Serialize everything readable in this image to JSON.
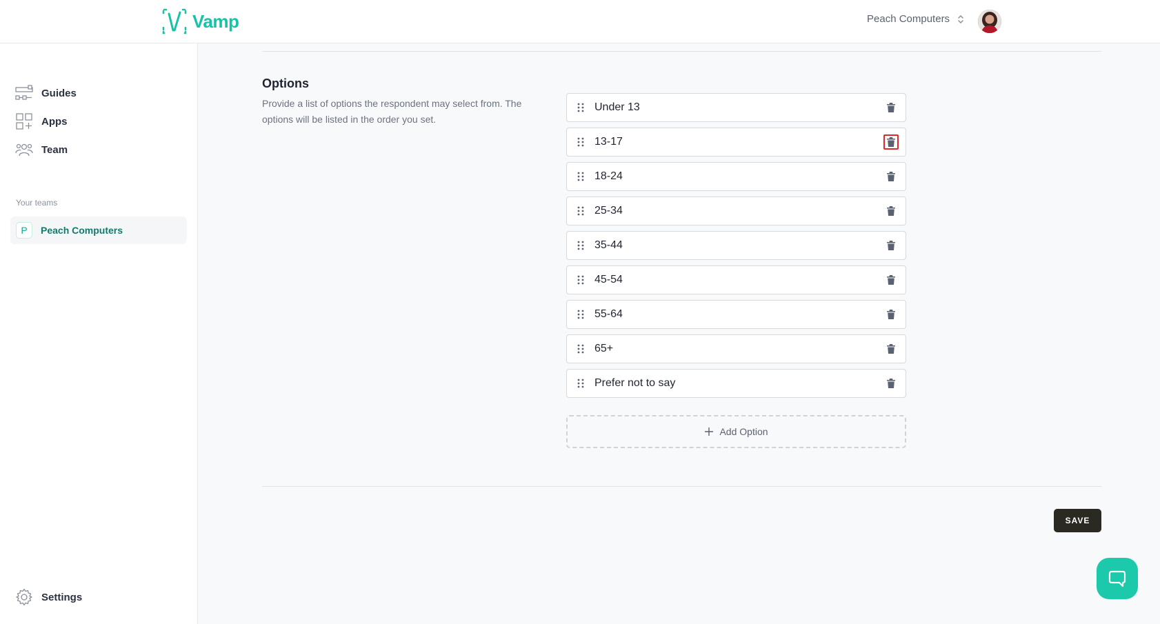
{
  "brand": {
    "name": "Vamp",
    "color": "#19c2a7"
  },
  "header": {
    "team_switcher_label": "Peach Computers"
  },
  "sidebar": {
    "nav": [
      {
        "label": "Guides",
        "icon": "guides-icon"
      },
      {
        "label": "Apps",
        "icon": "apps-icon"
      },
      {
        "label": "Team",
        "icon": "team-icon"
      }
    ],
    "teams_section_label": "Your teams",
    "active_team": {
      "badge": "P",
      "name": "Peach Computers"
    },
    "settings_label": "Settings"
  },
  "main": {
    "options_title": "Options",
    "options_description": "Provide a list of options the respondent may select from. The options will be listed in the order you set.",
    "options": [
      "Under 13",
      "13-17",
      "18-24",
      "25-34",
      "35-44",
      "45-54",
      "55-64",
      "65+",
      "Prefer not to say"
    ],
    "add_option_label": "Add Option",
    "save_label": "SAVE"
  }
}
